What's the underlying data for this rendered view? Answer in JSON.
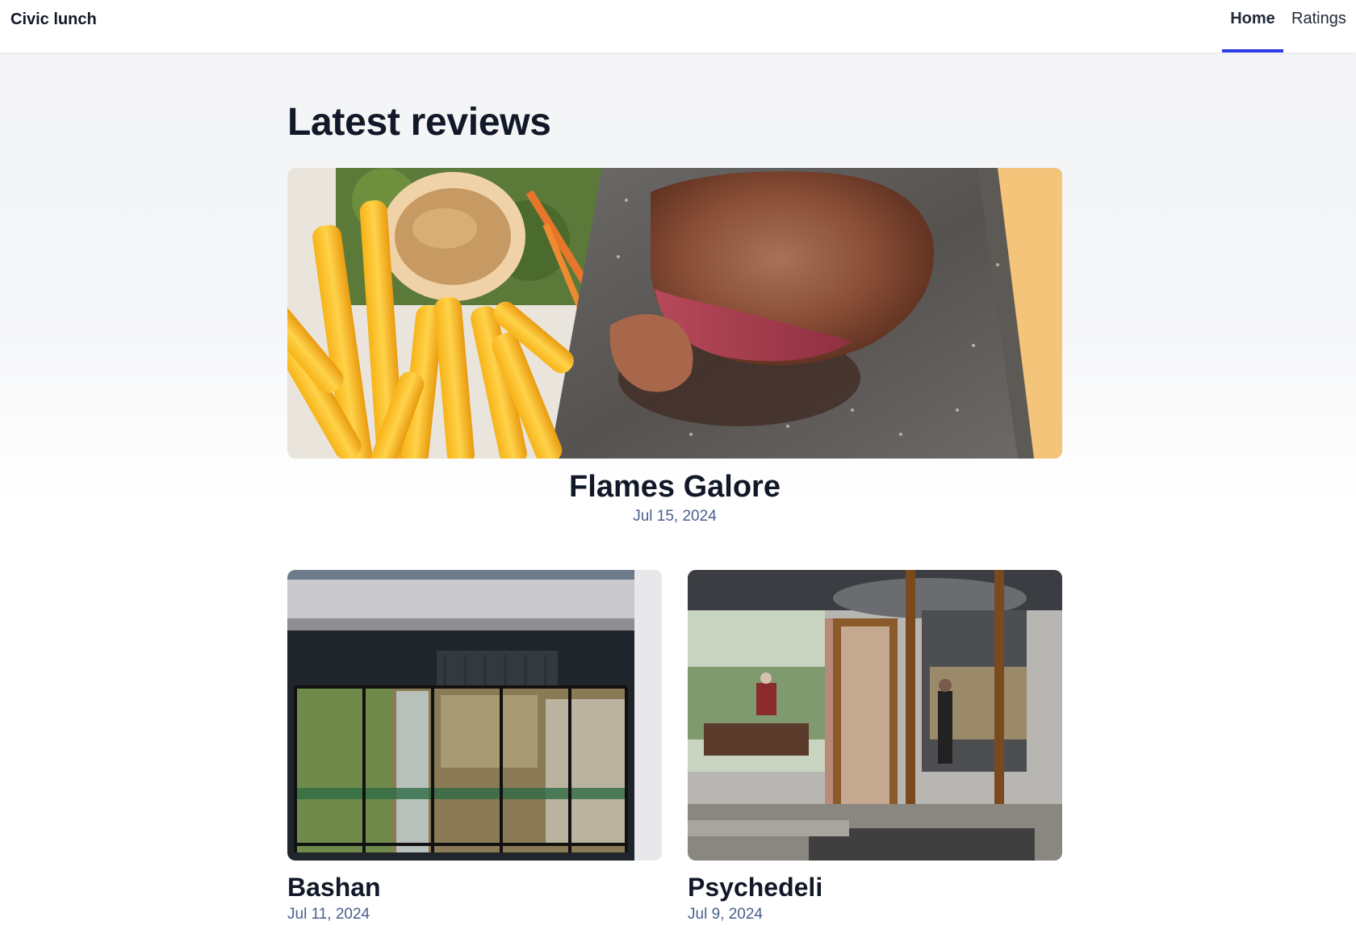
{
  "header": {
    "brand": "Civic lunch",
    "nav": [
      {
        "label": "Home",
        "active": true
      },
      {
        "label": "Ratings",
        "active": false
      }
    ],
    "accent_color": "#2f3de6"
  },
  "main": {
    "heading": "Latest reviews",
    "featured": {
      "name": "Flames Galore",
      "date": "Jul 15, 2024",
      "image": "steak-and-chips-photo"
    },
    "reviews": [
      {
        "name": "Bashan",
        "date": "Jul 11, 2024",
        "image": "restaurant-storefront-photo"
      },
      {
        "name": "Psychedeli",
        "date": "Jul 9, 2024",
        "image": "cafe-entrance-photo"
      }
    ]
  }
}
